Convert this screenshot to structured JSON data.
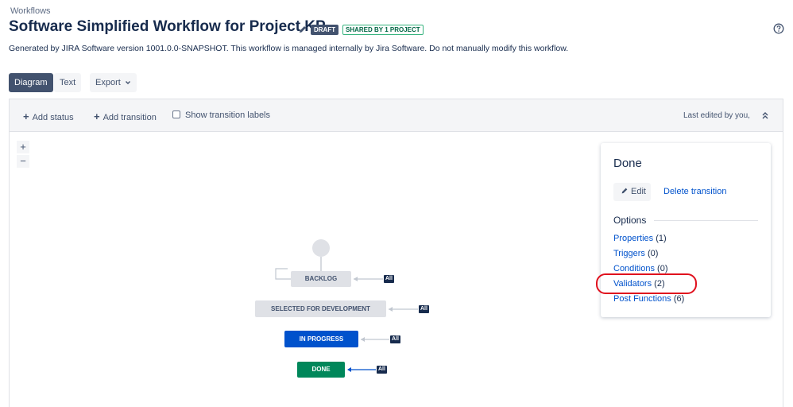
{
  "header": {
    "breadcrumb": "Workflows",
    "title": "Software Simplified Workflow for Project KP",
    "draft_badge": "DRAFT",
    "shared_badge": "SHARED BY 1 PROJECT",
    "description": "Generated by JIRA Software version 1001.0.0-SNAPSHOT. This workflow is managed internally by Jira Software. Do not manually modify this workflow."
  },
  "tabs": [
    {
      "label": "Diagram",
      "selected": true
    },
    {
      "label": "Text",
      "selected": false
    }
  ],
  "export": {
    "label": "Export"
  },
  "toolbar": {
    "add_status": "Add status",
    "add_transition": "Add transition",
    "show_labels": "Show transition labels",
    "show_labels_checked": false,
    "last_edited": "Last edited by you,"
  },
  "zoom": {
    "in": "+",
    "out": "−"
  },
  "diagram": {
    "statuses": [
      {
        "name": "BACKLOG",
        "color": "#dfe1e6"
      },
      {
        "name": "SELECTED FOR DEVELOPMENT",
        "color": "#dfe1e6"
      },
      {
        "name": "IN PROGRESS",
        "color": "#0052cc"
      },
      {
        "name": "DONE",
        "color": "#00875a"
      }
    ],
    "all_label": "All"
  },
  "panel": {
    "title": "Done",
    "edit_label": "Edit",
    "delete_label": "Delete transition",
    "options_heading": "Options",
    "options": [
      {
        "label": "Properties",
        "count": "(1)"
      },
      {
        "label": "Triggers",
        "count": "(0)"
      },
      {
        "label": "Conditions",
        "count": "(0)"
      },
      {
        "label": "Validators",
        "count": "(2)"
      },
      {
        "label": "Post Functions",
        "count": "(6)"
      }
    ]
  },
  "colors": {
    "primary": "#0052cc",
    "success": "#00875a",
    "annotation": "#e0101d"
  }
}
